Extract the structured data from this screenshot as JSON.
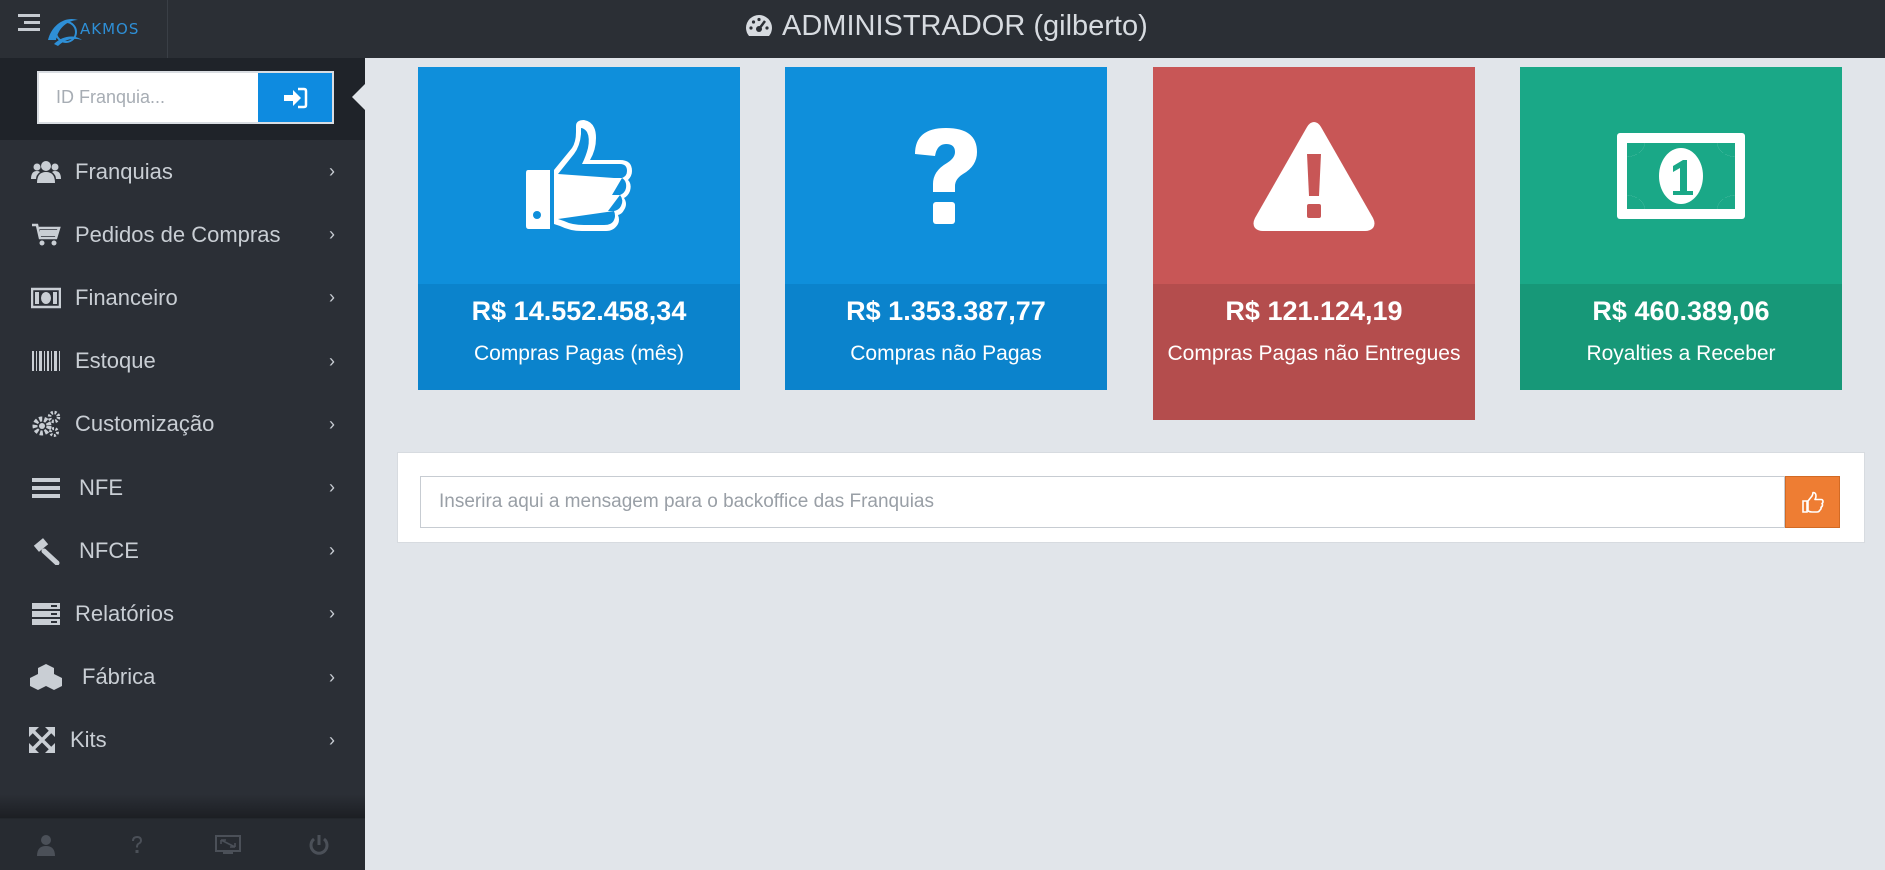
{
  "header": {
    "logo_text": "AKMOS",
    "title": "ADMINISTRADOR (gilberto)",
    "title_icon": "dashboard-gauge-icon"
  },
  "sidebar": {
    "franchise_input": {
      "placeholder": "ID Franquia...",
      "value": ""
    },
    "login_icon": "sign-in-icon",
    "items": [
      {
        "label": "Franquias",
        "icon": "users-icon"
      },
      {
        "label": "Pedidos de Compras",
        "icon": "cart-icon"
      },
      {
        "label": "Financeiro",
        "icon": "money-icon"
      },
      {
        "label": "Estoque",
        "icon": "barcode-icon"
      },
      {
        "label": "Customização",
        "icon": "gears-icon"
      },
      {
        "label": "NFE",
        "icon": "list-icon"
      },
      {
        "label": "NFCE",
        "icon": "gavel-icon"
      },
      {
        "label": "Relatórios",
        "icon": "server-icon"
      },
      {
        "label": "Fábrica",
        "icon": "cubes-icon"
      },
      {
        "label": "Kits",
        "icon": "arrows-icon"
      }
    ],
    "footer": [
      "user-icon",
      "question-icon",
      "screen-icon",
      "power-icon"
    ]
  },
  "cards": [
    {
      "value": "R$ 14.552.458,34",
      "label": "Compras Pagas (mês)",
      "icon": "thumbs-up-icon",
      "color": "#0f8fdb"
    },
    {
      "value": "R$ 1.353.387,77",
      "label": "Compras não Pagas",
      "icon": "question-icon",
      "color": "#0f8fdb"
    },
    {
      "value": "R$ 121.124,19",
      "label": "Compras Pagas não Entregues",
      "icon": "warning-icon",
      "color": "#c85656"
    },
    {
      "value": "R$ 460.389,06",
      "label": "Royalties a Receber",
      "icon": "money-bill-icon",
      "color": "#1aa887"
    }
  ],
  "message": {
    "placeholder": "Inserira aqui a mensagem para o backoffice das Franquias",
    "value": "",
    "send_icon": "thumbs-up-icon",
    "send_color": "#ee7d33"
  }
}
